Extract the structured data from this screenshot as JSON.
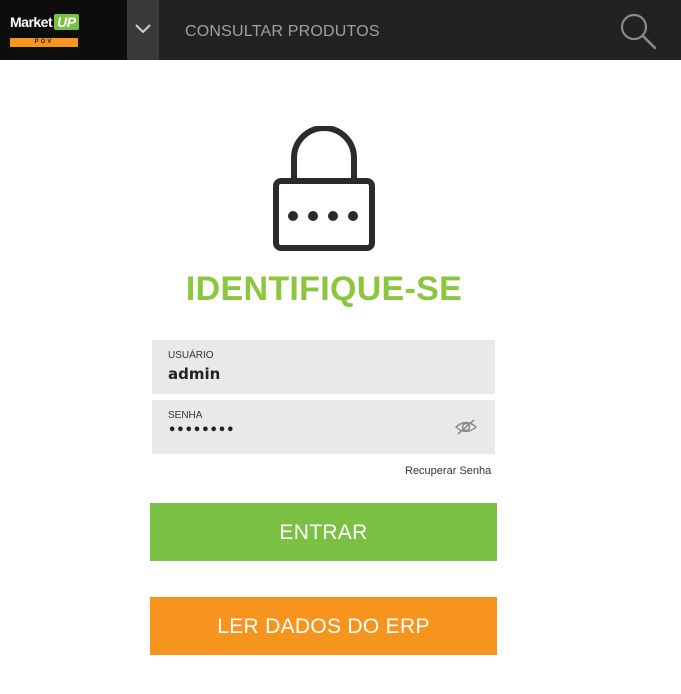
{
  "header": {
    "logo_text": "Market",
    "logo_badge": "UP",
    "logo_sub": "POV",
    "nav_title": "CONSULTAR PRODUTOS",
    "menu_icon": "chevron-down-icon",
    "search_icon": "search-icon"
  },
  "main": {
    "lock_icon": "lock-icon",
    "heading": "IDENTIFIQUE-SE",
    "username": {
      "label": "USUÁRIO",
      "value": "admin"
    },
    "password": {
      "label": "SENHA",
      "value": "••••••••",
      "toggle_icon": "eye-icon"
    },
    "recover_link": "Recuperar Senha",
    "enter_button": "ENTRAR",
    "erp_button": "LER DADOS DO ERP"
  },
  "colors": {
    "brand_green": "#8cc63f",
    "button_green": "#7ac143",
    "button_orange": "#f7941d",
    "topbar": "#222222"
  }
}
